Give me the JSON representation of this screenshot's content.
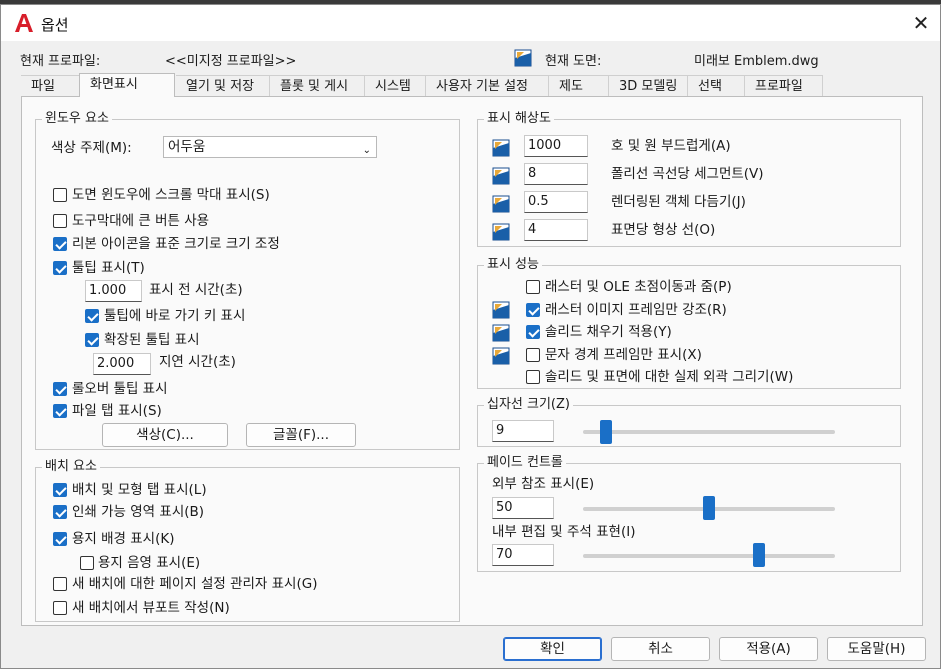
{
  "window": {
    "title": "옵션",
    "close_glyph": "✕"
  },
  "header": {
    "profile_label": "현재 프로파일:",
    "profile_value": "<<미지정 프로파일>>",
    "drawing_label": "현재 도면:",
    "drawing_value": "미래보 Emblem.dwg"
  },
  "tabs": [
    "파일",
    "화면표시",
    "열기 및 저장",
    "플롯 및 게시",
    "시스템",
    "사용자 기본 설정",
    "제도",
    "3D 모델링",
    "선택",
    "프로파일"
  ],
  "window_elements": {
    "title": "윈도우 요소",
    "color_scheme_label": "색상 주제(M):",
    "color_scheme_value": "어두움",
    "scrollbars": "도면 윈도우에 스크롤 막대 표시(S)",
    "large_buttons": "도구막대에 큰 버튼 사용",
    "resize_ribbon": "리본 아이콘을 표준 크기로 크기 조정",
    "tooltips": "툴팁 표시(T)",
    "delay_value": "1.000",
    "delay_label": "표시 전 시간(초)",
    "shortcut_tooltips": "툴팁에 바로 가기 키 표시",
    "extended_tooltips": "확장된 툴팁 표시",
    "ext_delay_value": "2.000",
    "ext_delay_label": "지연 시간(초)",
    "rollover": "롤오버 툴팁 표시",
    "file_tabs": "파일 탭 표시(S)",
    "colors_button": "색상(C)...",
    "fonts_button": "글꼴(F)..."
  },
  "layout_elements": {
    "title": "배치 요소",
    "items": [
      {
        "label": "배치 및 모형 탭 표시(L)",
        "checked": true
      },
      {
        "label": "인쇄 가능 영역 표시(B)",
        "checked": true
      },
      {
        "label": "용지 배경 표시(K)",
        "checked": true
      },
      {
        "label": "용지 음영 표시(E)",
        "checked": false
      },
      {
        "label": "새 배치에 대한 페이지 설정 관리자 표시(G)",
        "checked": false
      },
      {
        "label": "새 배치에서 뷰포트 작성(N)",
        "checked": false
      }
    ]
  },
  "resolution": {
    "title": "표시 해상도",
    "rows": [
      {
        "value": "1000",
        "label": "호 및 원 부드럽게(A)"
      },
      {
        "value": "8",
        "label": "폴리선 곡선당 세그먼트(V)"
      },
      {
        "value": "0.5",
        "label": "렌더링된 객체 다듬기(J)"
      },
      {
        "value": "4",
        "label": "표면당 형상 선(O)"
      }
    ]
  },
  "performance": {
    "title": "표시 성능",
    "items": [
      {
        "label": "래스터 및 OLE 초점이동과 줌(P)",
        "checked": false
      },
      {
        "label": "래스터 이미지 프레임만 강조(R)",
        "checked": true
      },
      {
        "label": "솔리드 채우기 적용(Y)",
        "checked": true
      },
      {
        "label": "문자 경계 프레임만 표시(X)",
        "checked": false
      },
      {
        "label": "솔리드 및 표면에 대한 실제 외곽 그리기(W)",
        "checked": false
      }
    ]
  },
  "crosshair": {
    "title": "십자선 크기(Z)",
    "value": "9",
    "fraction": 0.09
  },
  "fade": {
    "title": "페이드 컨트롤",
    "xref_label": "외부 참조 표시(E)",
    "xref_value": "50",
    "xref_fraction": 0.5,
    "inplace_label": "내부 편집 및 주석 표현(I)",
    "inplace_value": "70",
    "inplace_fraction": 0.7
  },
  "footer": {
    "ok": "확인",
    "cancel": "취소",
    "apply": "적용(A)",
    "help": "도움말(H)"
  },
  "colors": {
    "accent": "#1a6fc7",
    "logo": "#d81e2a"
  }
}
